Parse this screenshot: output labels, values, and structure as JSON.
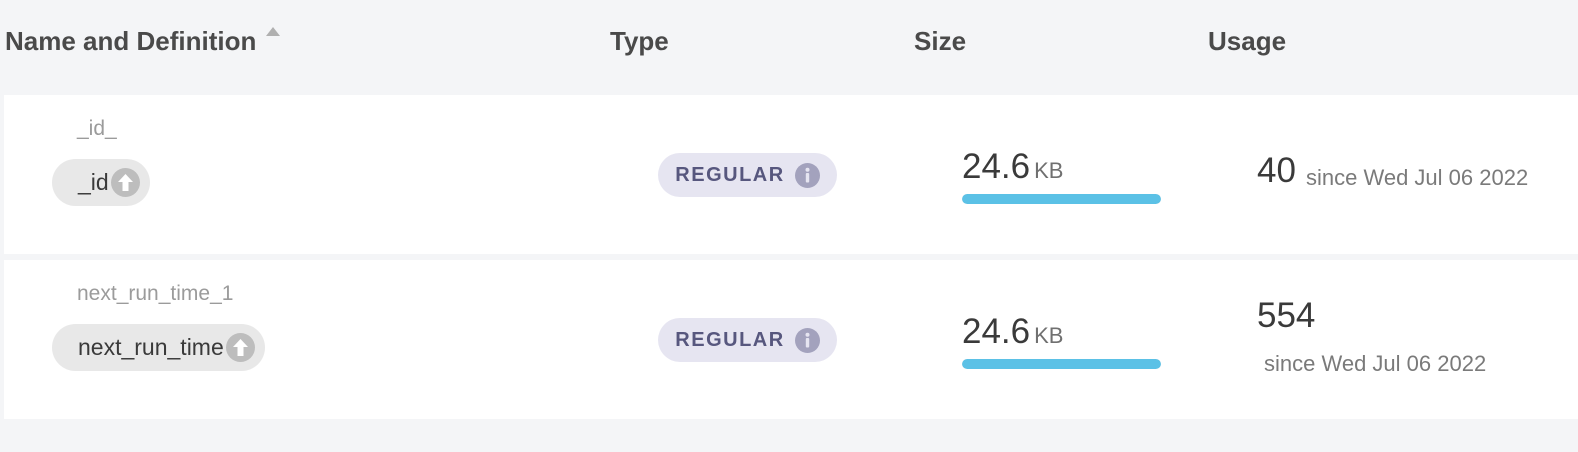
{
  "columns": {
    "name": "Name and Definition",
    "type": "Type",
    "size": "Size",
    "usage": "Usage"
  },
  "colors": {
    "size_bar": "#5bc1e6",
    "type_badge_bg": "#e6e5f1",
    "type_badge_text": "#57577e",
    "field_pill_bg": "#e8e8e8"
  },
  "indexes": [
    {
      "name": "_id_",
      "field": "_id",
      "direction_icon": "arrow-up-icon",
      "type": "REGULAR",
      "size_value": "24.6",
      "size_unit": "KB",
      "size_fraction": 1.0,
      "usage_count": "40",
      "usage_since": "since Wed Jul 06 2022"
    },
    {
      "name": "next_run_time_1",
      "field": "next_run_time",
      "direction_icon": "arrow-up-icon",
      "type": "REGULAR",
      "size_value": "24.6",
      "size_unit": "KB",
      "size_fraction": 1.0,
      "usage_count": "554",
      "usage_since": "since Wed Jul 06 2022"
    }
  ]
}
